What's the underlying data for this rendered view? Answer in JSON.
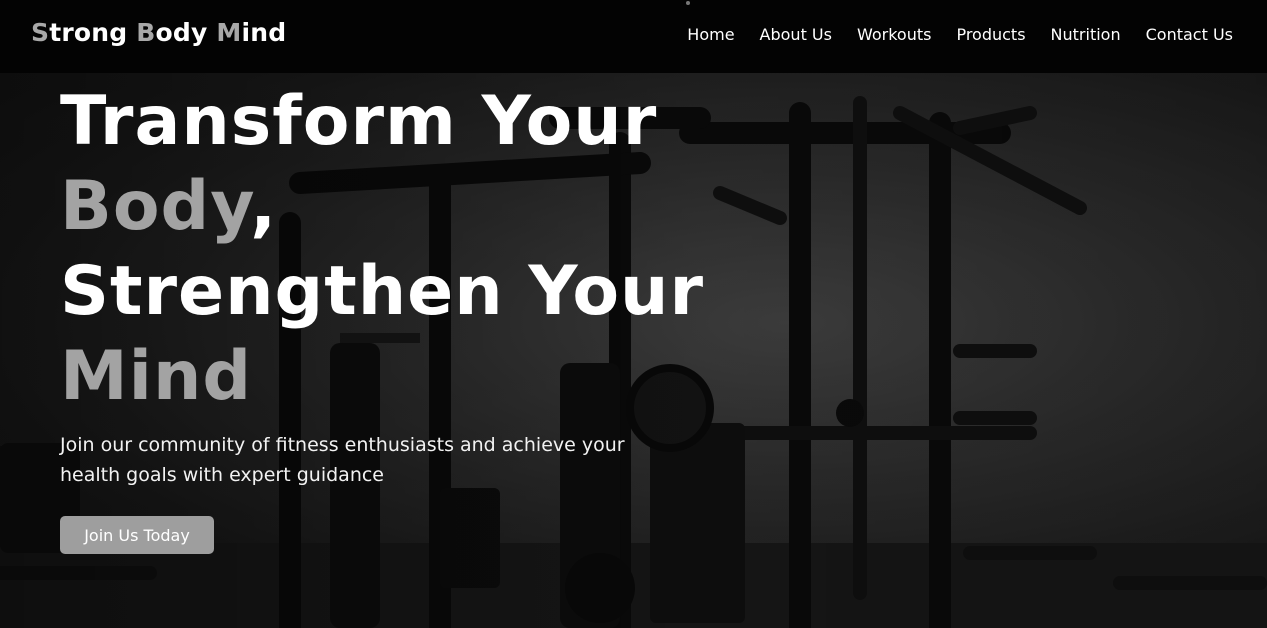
{
  "brand": {
    "letters": [
      {
        "accent": "S",
        "rest": "trong"
      },
      {
        "accent": "B",
        "rest": "ody"
      },
      {
        "accent": "M",
        "rest": "ind"
      }
    ]
  },
  "nav": {
    "items": [
      "Home",
      "About Us",
      "Workouts",
      "Products",
      "Nutrition",
      "Contact Us"
    ]
  },
  "hero": {
    "headline": {
      "line1": "Transform Your",
      "line2_grey": "Body",
      "line2_punct": ",",
      "line3": "Strengthen Your",
      "line4_grey": "Mind"
    },
    "subtitle": "Join our community of fitness enthusiasts and achieve your health goals with expert guidance",
    "cta_label": "Join Us Today"
  },
  "colors": {
    "header_bg": "#030303",
    "accent_grey": "#a3a3a3",
    "button_bg": "#9e9e9e",
    "text": "#ffffff"
  }
}
